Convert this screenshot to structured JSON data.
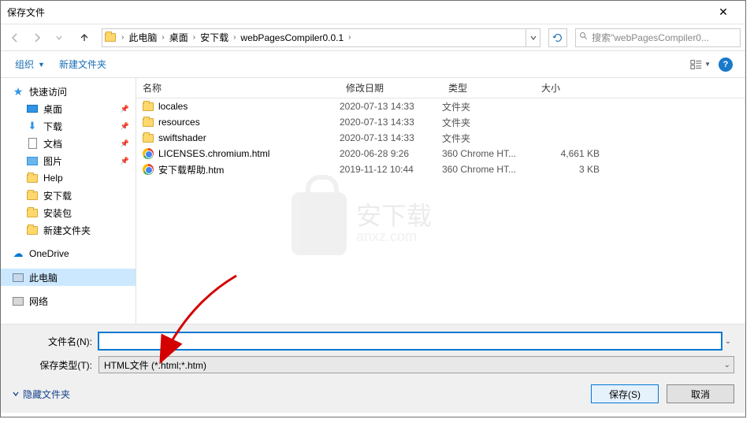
{
  "title": "保存文件",
  "breadcrumb": [
    "此电脑",
    "桌面",
    "安下载",
    "webPagesCompiler0.0.1"
  ],
  "search_placeholder": "搜索\"webPagesCompiler0...",
  "toolbar": {
    "organize": "组织",
    "newfolder": "新建文件夹"
  },
  "sidebar": {
    "quick_access": "快速访问",
    "items": [
      {
        "label": "桌面",
        "icon": "desktop",
        "pinned": true
      },
      {
        "label": "下载",
        "icon": "download",
        "pinned": true
      },
      {
        "label": "文档",
        "icon": "doc",
        "pinned": true
      },
      {
        "label": "图片",
        "icon": "pic",
        "pinned": true
      },
      {
        "label": "Help",
        "icon": "folder"
      },
      {
        "label": "安下载",
        "icon": "folder"
      },
      {
        "label": "安装包",
        "icon": "folder"
      },
      {
        "label": "新建文件夹",
        "icon": "folder"
      }
    ],
    "onedrive": "OneDrive",
    "thispc": "此电脑",
    "network": "网络"
  },
  "columns": {
    "name": "名称",
    "date": "修改日期",
    "type": "类型",
    "size": "大小"
  },
  "files": [
    {
      "name": "locales",
      "date": "2020-07-13 14:33",
      "type": "文件夹",
      "size": "",
      "icon": "folder"
    },
    {
      "name": "resources",
      "date": "2020-07-13 14:33",
      "type": "文件夹",
      "size": "",
      "icon": "folder"
    },
    {
      "name": "swiftshader",
      "date": "2020-07-13 14:33",
      "type": "文件夹",
      "size": "",
      "icon": "folder"
    },
    {
      "name": "LICENSES.chromium.html",
      "date": "2020-06-28 9:26",
      "type": "360 Chrome HT...",
      "size": "4,661 KB",
      "icon": "chrome"
    },
    {
      "name": "安下载帮助.htm",
      "date": "2019-11-12 10:44",
      "type": "360 Chrome HT...",
      "size": "3 KB",
      "icon": "chrome"
    }
  ],
  "filename_label": "文件名(N):",
  "filetype_label": "保存类型(T):",
  "filename_value": "",
  "filetype_value": "HTML文件 (*.html;*.htm)",
  "hide_folders": "隐藏文件夹",
  "save_btn": "保存(S)",
  "cancel_btn": "取消",
  "watermark": {
    "main": "安下载",
    "sub": "anxz.com"
  }
}
